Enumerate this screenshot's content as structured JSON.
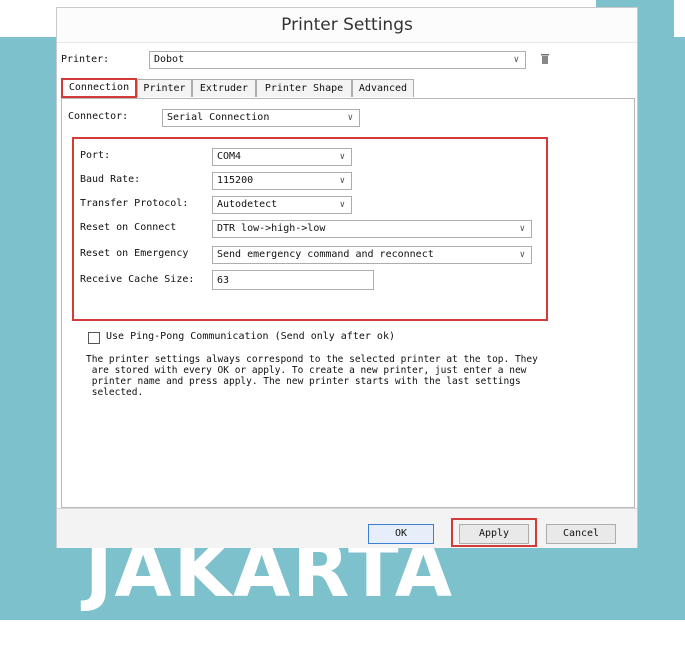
{
  "watermark": {
    "text": "JAKARTA"
  },
  "window": {
    "title": "Printer Settings"
  },
  "printer": {
    "label": "Printer:",
    "value": "Dobot"
  },
  "tabs": [
    {
      "label": "Connection"
    },
    {
      "label": "Printer"
    },
    {
      "label": "Extruder"
    },
    {
      "label": "Printer Shape"
    },
    {
      "label": "Advanced"
    }
  ],
  "connector": {
    "label": "Connector:",
    "value": "Serial Connection"
  },
  "settings": {
    "port": {
      "label": "Port:",
      "value": "COM4"
    },
    "baud_rate": {
      "label": "Baud Rate:",
      "value": "115200"
    },
    "transfer_protocol": {
      "label": "Transfer Protocol:",
      "value": "Autodetect"
    },
    "reset_on_connect": {
      "label": "Reset on Connect",
      "value": "DTR low->high->low"
    },
    "reset_on_emergency": {
      "label": "Reset on Emergency",
      "value": "Send emergency command and reconnect"
    },
    "receive_cache_size": {
      "label": "Receive Cache Size:",
      "value": "63"
    }
  },
  "ping_pong": {
    "label": "Use Ping-Pong Communication (Send only after ok)",
    "checked": false
  },
  "info_text": "The printer settings always correspond to the selected printer at the top. They\n are stored with every OK or apply. To create a new printer, just enter a new\n printer name and press apply. The new printer starts with the last settings\n selected.",
  "buttons": {
    "ok": "OK",
    "apply": "Apply",
    "cancel": "Cancel"
  },
  "colors": {
    "highlight": "#d33a3a",
    "background_band": "#7dc1cc",
    "primary_button": "#3c7fd6"
  },
  "icons": {
    "dropdown": "chevron-down-icon",
    "delete": "trash-icon"
  }
}
